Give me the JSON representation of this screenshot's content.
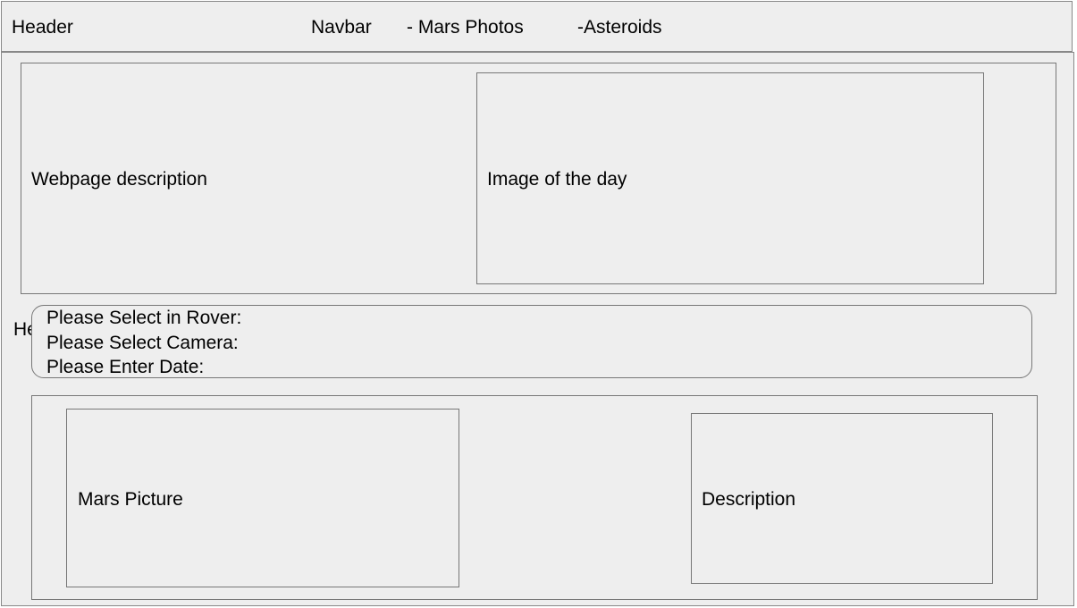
{
  "header": {
    "label": "Header",
    "navbar": {
      "label": "Navbar",
      "items": [
        "- Mars Photos",
        "-Asteroids"
      ]
    }
  },
  "hero": {
    "description_label": "Webpage description",
    "image_of_day_label": "Image of the day"
  },
  "partial_label": "He",
  "form": {
    "rover_label": "Please Select in Rover:",
    "camera_label": "Please Select Camera:",
    "date_label": "Please Enter Date:"
  },
  "gallery": {
    "picture_label": "Mars Picture",
    "description_label": "Description"
  }
}
